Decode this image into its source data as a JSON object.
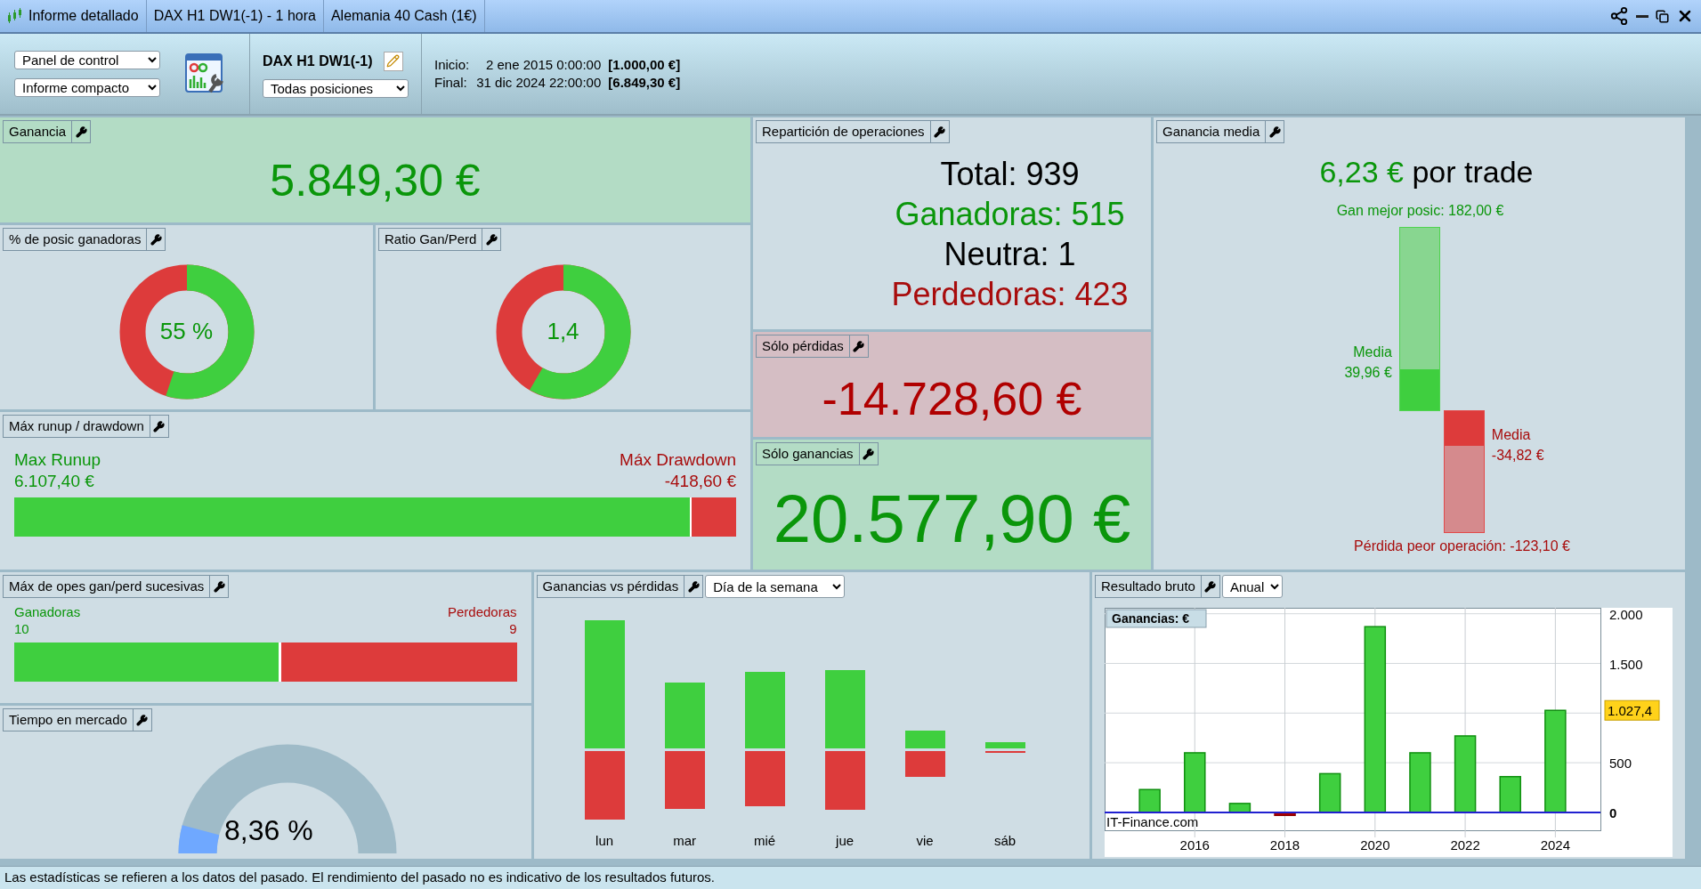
{
  "tabs": [
    {
      "label": "Informe detallado",
      "kind": "report"
    },
    {
      "label": "DAX H1 DW1(-1) - 1 hora",
      "kind": "plain"
    },
    {
      "label": "Alemania 40 Cash (1€)",
      "kind": "plain"
    }
  ],
  "toolbar": {
    "view_select": "Panel de control",
    "report_select": "Informe compacto",
    "system_name": "DAX H1 DW1(-1)",
    "positions_select": "Todas posiciones",
    "start_label": "Inicio:",
    "start_date": "2 ene 2015 0:00:00",
    "start_capital": "[1.000,00 €]",
    "end_label": "Final:",
    "end_date": "31 dic 2024 22:00:00",
    "end_capital": "[6.849,30 €]"
  },
  "ganancia": {
    "title": "Ganancia",
    "value": "5.849,30 €"
  },
  "pct_winners": {
    "title": "% de posic ganadoras",
    "value": "55 %",
    "level": 0.55
  },
  "ratio": {
    "title": "Ratio Gan/Perd",
    "value": "1,4",
    "level": 0.583
  },
  "runup": {
    "title": "Máx runup / drawdown",
    "runup_label": "Max Runup",
    "runup_value": "6.107,40 €",
    "drawdown_label": "Máx Drawdown",
    "drawdown_value": "-418,60 €",
    "level": 0.936
  },
  "distribution": {
    "title": "Repartición de operaciones",
    "lines": [
      {
        "text": "Total: 939",
        "kind": "total"
      },
      {
        "text": "Ganadoras: 515",
        "kind": "win"
      },
      {
        "text": "Neutra: 1",
        "kind": "total"
      },
      {
        "text": "Perdedoras: 423",
        "kind": "loss"
      }
    ]
  },
  "losses_only": {
    "title": "Sólo pérdidas",
    "value": "-14.728,60 €"
  },
  "gains_only": {
    "title": "Sólo ganancias",
    "value": "20.577,90 €"
  },
  "avg_gain": {
    "title": "Ganancia media",
    "value": "6,23 €",
    "suffix": "por trade",
    "best_label": "Gan mejor posic: 182,00 €",
    "win_avg_label": "Media",
    "win_avg_value": "39,96 €",
    "loss_avg_label": "Media",
    "loss_avg_value": "-34,82 €",
    "worst_label": "Pérdida peor operación: -123,10 €"
  },
  "consecutive": {
    "title": "Máx de opes gan/perd sucesivas",
    "win_label": "Ganadoras",
    "win_value": "10",
    "loss_label": "Perdedoras",
    "loss_value": "9",
    "level": 0.526
  },
  "time_in_market": {
    "title": "Tiempo en mercado",
    "value": "8,36 %",
    "level": 0.0836
  },
  "gains_vs_losses": {
    "title": "Ganancias vs pérdidas",
    "period_select": "Día de la semana",
    "days": [
      "lun",
      "mar",
      "mié",
      "jue",
      "vie",
      "sáb"
    ]
  },
  "gross_result": {
    "title": "Resultado bruto",
    "period_select": "Anual",
    "chart_data": {
      "type": "bar",
      "title": "Ganancias: €",
      "x": [
        2015,
        2016,
        2017,
        2018,
        2019,
        2020,
        2021,
        2022,
        2023,
        2024
      ],
      "values": [
        230,
        600,
        90,
        -30,
        390,
        1870,
        600,
        770,
        360,
        1027.4
      ],
      "xlim": [
        2014,
        2025
      ],
      "ylim": [
        -180,
        2060
      ],
      "grid": true,
      "ref_lines": [
        {
          "axis": "y",
          "value": 0,
          "color": "#2020d0"
        }
      ],
      "xticks": [
        2016,
        2018,
        2020,
        2022,
        2024
      ],
      "yticks": [
        {
          "value": 0,
          "label": "0"
        },
        {
          "value": 500,
          "label": "500"
        },
        {
          "value": 1500,
          "label": "1.500"
        },
        {
          "value": 2000,
          "label": "2.000"
        }
      ],
      "annotations": [
        "1.027,4"
      ]
    },
    "credit": "IT-Finance.com"
  },
  "footer": "Las estadísticas se refieren a los datos del pasado. El rendimiento del pasado no es indicativo de los resultados futuros."
}
